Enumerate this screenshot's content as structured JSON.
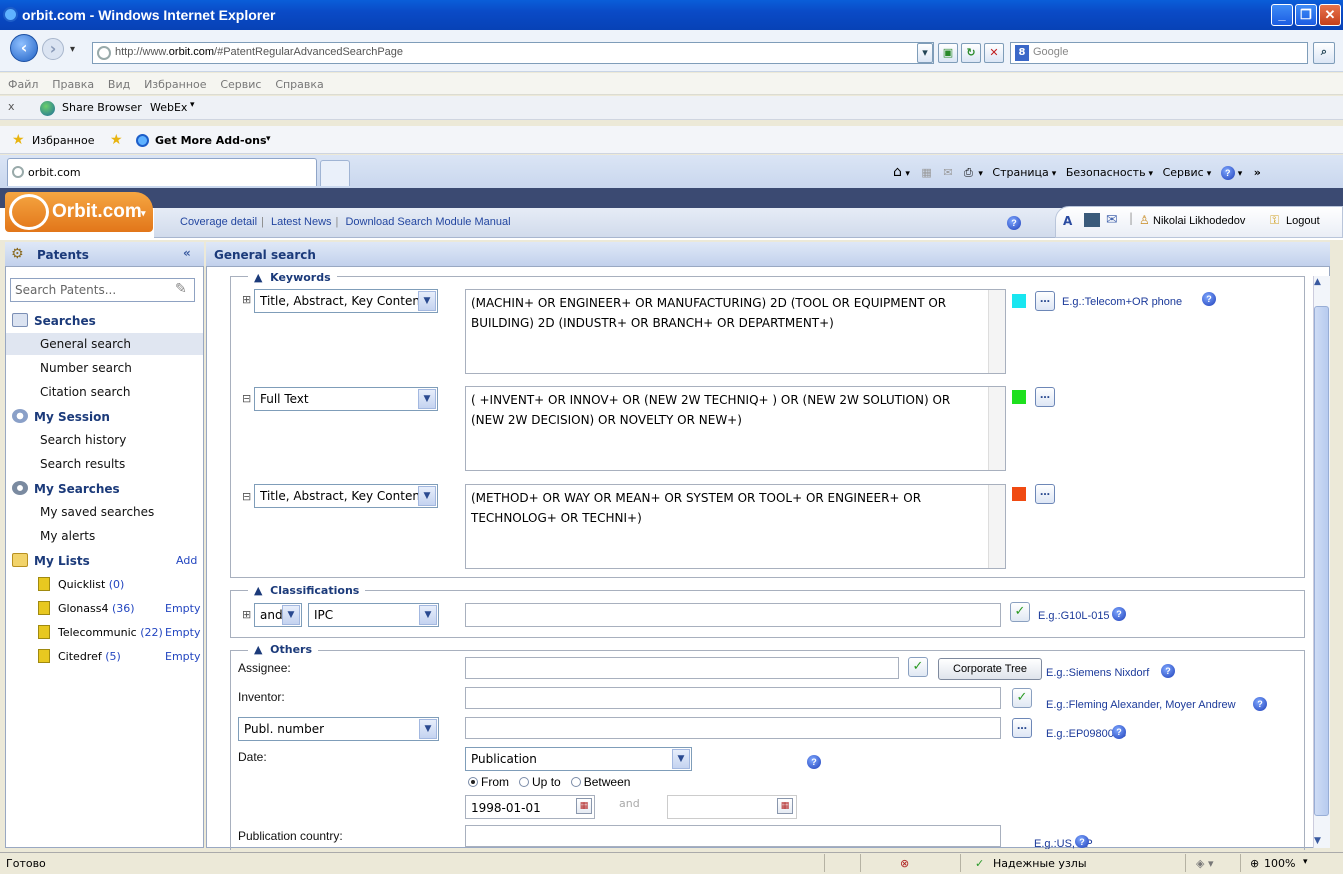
{
  "window": {
    "title": "orbit.com - Windows Internet Explorer"
  },
  "browser": {
    "url_prefix": "http://www.",
    "url_domain": "orbit.com",
    "url_suffix": "/#PatentRegularAdvancedSearchPage",
    "search_placeholder": "Google",
    "menu": [
      "Файл",
      "Правка",
      "Вид",
      "Избранное",
      "Сервис",
      "Справка"
    ],
    "toolbar_close": "x",
    "share_browser": "Share Browser",
    "webex": "WebEx",
    "favorites": "Избранное",
    "get_addons": "Get More Add-ons",
    "tab_title": "orbit.com",
    "cmd_page": "Страница",
    "cmd_security": "Безопасность",
    "cmd_service": "Сервис"
  },
  "orbit": {
    "logo": "Orbit.com",
    "links": [
      "Coverage detail",
      "Latest News",
      "Download Search Module Manual"
    ],
    "user": "Nikolai Likhodedov",
    "logout": "Logout"
  },
  "sidebar": {
    "title": "Patents",
    "search_placeholder": "Search Patents...",
    "groups": {
      "searches": "Searches",
      "session": "My Session",
      "my_searches": "My Searches",
      "lists": "My Lists"
    },
    "items": {
      "general": "General search",
      "number": "Number search",
      "citation": "Citation search",
      "history": "Search history",
      "results": "Search results",
      "saved": "My saved searches",
      "alerts": "My alerts"
    },
    "add": "Add",
    "lists": [
      {
        "name": "Quicklist",
        "count": "(0)",
        "action": ""
      },
      {
        "name": "Glonass4",
        "count": "(36)",
        "action": "Empty"
      },
      {
        "name": "Telecommunic",
        "count": "(22)",
        "action": "Empty"
      },
      {
        "name": "Citedref",
        "count": "(5)",
        "action": "Empty"
      }
    ]
  },
  "main": {
    "title": "General search",
    "keywords": {
      "legend": "Keywords",
      "rows": [
        {
          "field": "Title, Abstract, Key Content",
          "query": "(MACHIN+  OR ENGINEER+ OR   MANUFACTURING)  2D (TOOL OR EQUIPMENT OR BUILDING) 2D (INDUSTR+ OR BRANCH+ OR DEPARTMENT+)",
          "color": "#19e6f0"
        },
        {
          "field": "Full Text",
          "query": "( +INVENT+ OR INNOV+ OR (NEW 2W TECHNIQ+ ) OR (NEW 2W SOLUTION)  OR (NEW 2W DECISION) OR NOVELTY OR NEW+)",
          "color": "#1ee01e"
        },
        {
          "field": "Title, Abstract, Key Content",
          "query": "(METHOD+ OR WAY OR MEAN+ OR SYSTEM OR TOOL+ OR  ENGINEER+ OR TECHNOLOG+ OR TECHNI+)",
          "color": "#f04a12"
        }
      ],
      "example": "E.g.:Telecom+OR phone"
    },
    "classifications": {
      "legend": "Classifications",
      "operator": "and",
      "scheme": "IPC",
      "example": "E.g.:G10L-015"
    },
    "others": {
      "legend": "Others",
      "assignee_label": "Assignee:",
      "corporate_tree": "Corporate Tree",
      "assignee_example": "E.g.:Siemens Nixdorf",
      "inventor_label": "Inventor:",
      "inventor_example": "E.g.:Fleming Alexander, Moyer Andrew",
      "publ_field": "Publ. number",
      "publ_example": "E.g.:EP0980063",
      "date_label": "Date:",
      "date_type": "Publication",
      "radio_from": "From",
      "radio_upto": "Up to",
      "radio_between": "Between",
      "date_from": "1998-01-01",
      "and": "and",
      "country_label": "Publication country:",
      "country_example": "E.g.:US, EP"
    }
  },
  "status": {
    "left": "Готово",
    "zone": "Надежные узлы",
    "zoom": "100%"
  }
}
